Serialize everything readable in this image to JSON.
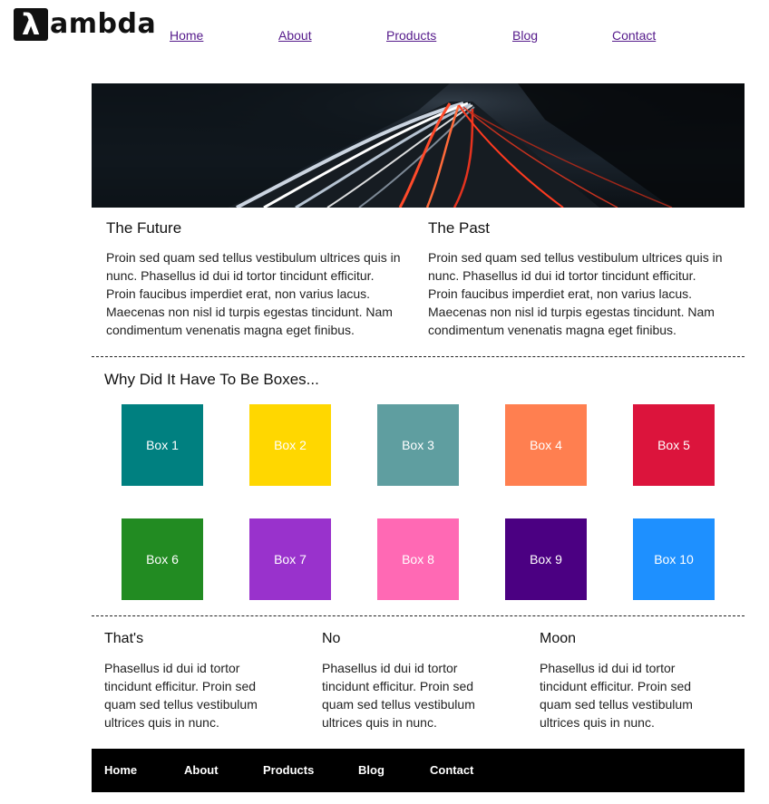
{
  "logo": {
    "mark": "λ",
    "text": "ambda"
  },
  "nav": [
    "Home",
    "About",
    "Products",
    "Blog",
    "Contact"
  ],
  "hero": {
    "alt": "Long-exposure highway light trails at night"
  },
  "columns": [
    {
      "title": "The Future",
      "text": "Proin sed quam sed tellus vestibulum ultrices quis in nunc. Phasellus id dui id tortor tincidunt efficitur. Proin faucibus imperdiet erat, non varius lacus. Maecenas non nisl id turpis egestas tincidunt. Nam condimentum venenatis magna eget finibus."
    },
    {
      "title": "The Past",
      "text": "Proin sed quam sed tellus vestibulum ultrices quis in nunc. Phasellus id dui id tortor tincidunt efficitur. Proin faucibus imperdiet erat, non varius lacus. Maecenas non nisl id turpis egestas tincidunt. Nam condimentum venenatis magna eget finibus."
    }
  ],
  "boxes_title": "Why Did It Have To Be Boxes...",
  "boxes": [
    {
      "label": "Box 1",
      "color": "#008080"
    },
    {
      "label": "Box 2",
      "color": "#FFD700"
    },
    {
      "label": "Box 3",
      "color": "#5F9EA0"
    },
    {
      "label": "Box 4",
      "color": "#FF7F50"
    },
    {
      "label": "Box 5",
      "color": "#DC143C"
    },
    {
      "label": "Box 6",
      "color": "#228B22"
    },
    {
      "label": "Box 7",
      "color": "#9932CC"
    },
    {
      "label": "Box 8",
      "color": "#FF69B4"
    },
    {
      "label": "Box 9",
      "color": "#4B0082"
    },
    {
      "label": "Box 10",
      "color": "#1E90FF"
    }
  ],
  "bottom": [
    {
      "title": "That's",
      "text": "Phasellus id dui id tortor tincidunt efficitur. Proin sed quam sed tellus vestibulum ultrices quis in nunc."
    },
    {
      "title": "No",
      "text": "Phasellus id dui id tortor tincidunt efficitur. Proin sed quam sed tellus vestibulum ultrices quis in nunc."
    },
    {
      "title": "Moon",
      "text": "Phasellus id dui id tortor tincidunt efficitur. Proin sed quam sed tellus vestibulum ultrices quis in nunc."
    }
  ],
  "footer_nav": [
    "Home",
    "About",
    "Products",
    "Blog",
    "Contact"
  ]
}
